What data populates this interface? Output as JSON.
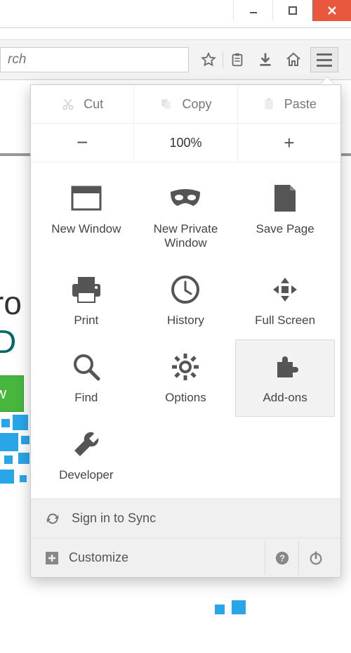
{
  "search": {
    "placeholder": "rch"
  },
  "edit": {
    "cut": "Cut",
    "copy": "Copy",
    "paste": "Paste"
  },
  "zoom": {
    "level": "100%"
  },
  "grid": {
    "new_window": "New Window",
    "new_private": "New Private Window",
    "save_page": "Save Page",
    "print": "Print",
    "history": "History",
    "full_screen": "Full Screen",
    "find": "Find",
    "options": "Options",
    "addons": "Add-ons",
    "developer": "Developer"
  },
  "sync": {
    "label": "Sign in to Sync"
  },
  "customize": {
    "label": "Customize"
  },
  "bg": {
    "line1": "ro",
    "line2": "D",
    "button": "Now"
  }
}
